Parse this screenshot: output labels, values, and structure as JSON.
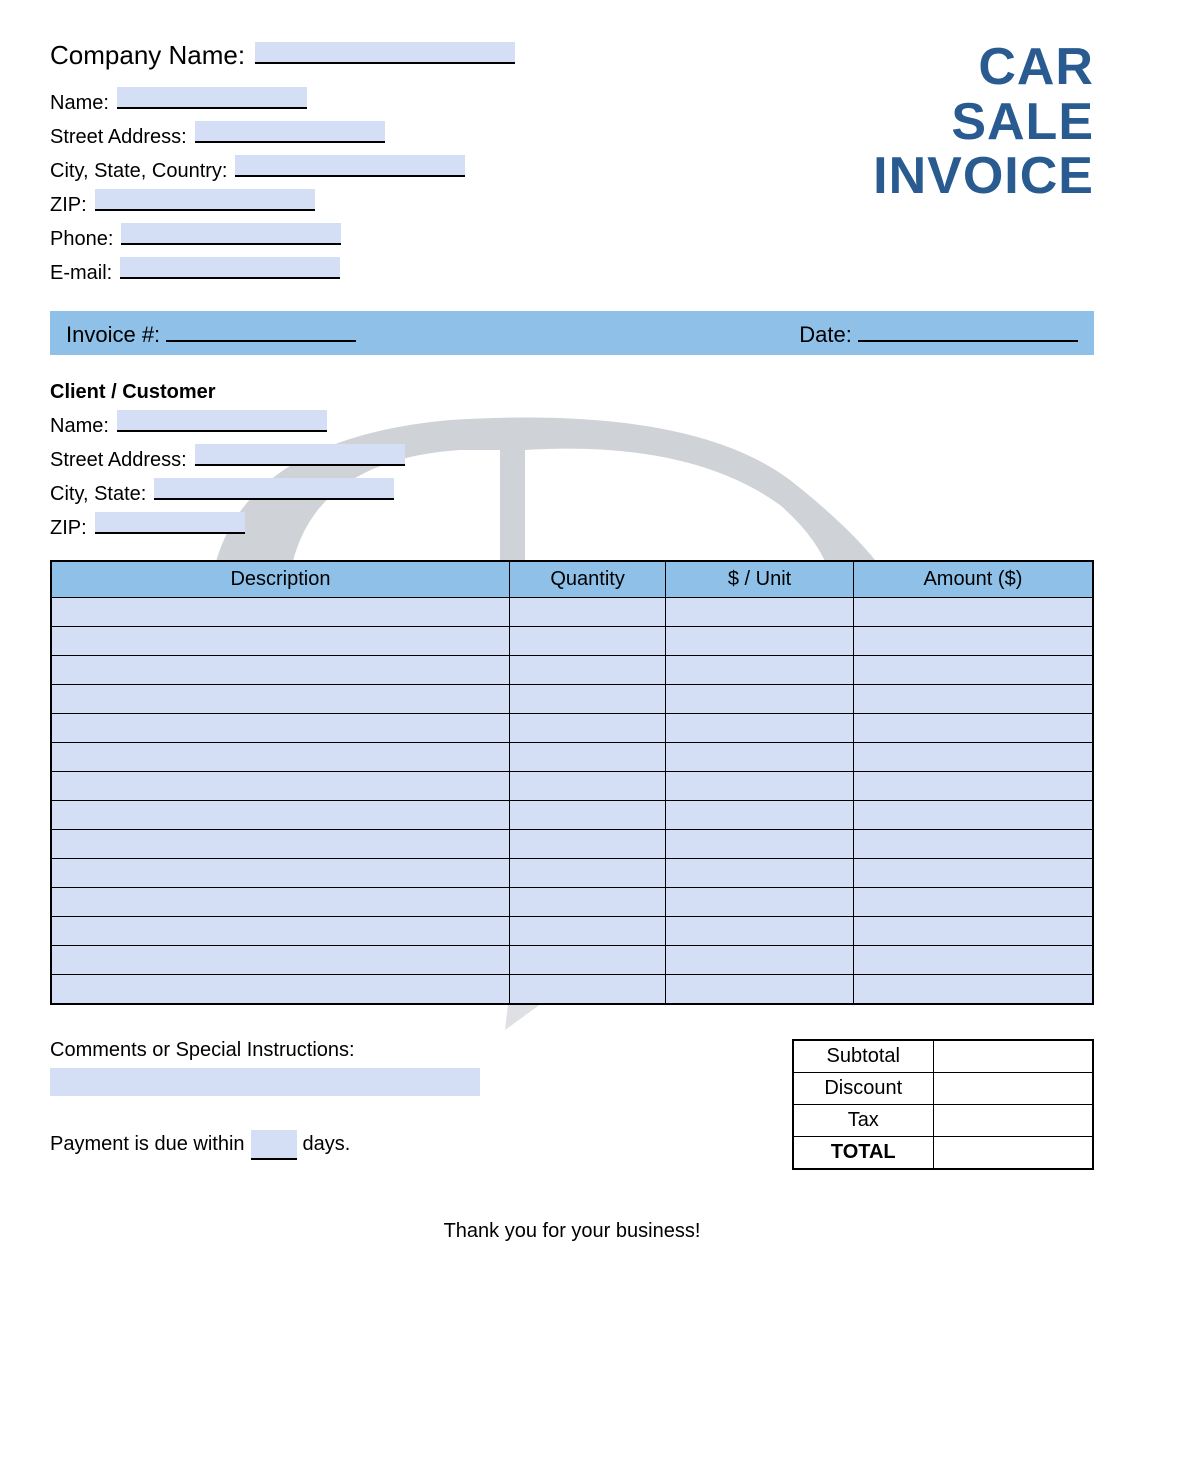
{
  "document": {
    "title_line1": "CAR",
    "title_line2": "SALE",
    "title_line3": "INVOICE"
  },
  "company": {
    "company_label": "Company Name:",
    "name_label": "Name:",
    "street_label": "Street Address:",
    "city_label": "City, State, Country:",
    "zip_label": "ZIP:",
    "phone_label": "Phone:",
    "email_label": "E-mail:",
    "company_value": "",
    "name_value": "",
    "street_value": "",
    "city_value": "",
    "zip_value": "",
    "phone_value": "",
    "email_value": ""
  },
  "invoice_bar": {
    "number_label": "Invoice #:",
    "number_value": "",
    "date_label": "Date:",
    "date_value": ""
  },
  "customer": {
    "section_title": "Client / Customer",
    "name_label": "Name:",
    "street_label": "Street Address:",
    "city_label": "City, State:",
    "zip_label": "ZIP:",
    "name_value": "",
    "street_value": "",
    "city_value": "",
    "zip_value": ""
  },
  "table": {
    "headers": {
      "description": "Description",
      "quantity": "Quantity",
      "unit": "$ / Unit",
      "amount": "Amount ($)"
    },
    "rows": [
      {
        "description": "",
        "quantity": "",
        "unit": "",
        "amount": ""
      },
      {
        "description": "",
        "quantity": "",
        "unit": "",
        "amount": ""
      },
      {
        "description": "",
        "quantity": "",
        "unit": "",
        "amount": ""
      },
      {
        "description": "",
        "quantity": "",
        "unit": "",
        "amount": ""
      },
      {
        "description": "",
        "quantity": "",
        "unit": "",
        "amount": ""
      },
      {
        "description": "",
        "quantity": "",
        "unit": "",
        "amount": ""
      },
      {
        "description": "",
        "quantity": "",
        "unit": "",
        "amount": ""
      },
      {
        "description": "",
        "quantity": "",
        "unit": "",
        "amount": ""
      },
      {
        "description": "",
        "quantity": "",
        "unit": "",
        "amount": ""
      },
      {
        "description": "",
        "quantity": "",
        "unit": "",
        "amount": ""
      },
      {
        "description": "",
        "quantity": "",
        "unit": "",
        "amount": ""
      },
      {
        "description": "",
        "quantity": "",
        "unit": "",
        "amount": ""
      },
      {
        "description": "",
        "quantity": "",
        "unit": "",
        "amount": ""
      },
      {
        "description": "",
        "quantity": "",
        "unit": "",
        "amount": ""
      }
    ]
  },
  "comments": {
    "label": "Comments or Special Instructions:",
    "value": "",
    "payment_prefix": "Payment is due within",
    "payment_days": "",
    "payment_suffix": "days."
  },
  "totals": {
    "subtotal_label": "Subtotal",
    "discount_label": "Discount",
    "tax_label": "Tax",
    "total_label": "TOTAL",
    "subtotal": "",
    "discount": "",
    "tax": "",
    "total": ""
  },
  "footer": {
    "text": "Thank you for your business!"
  }
}
